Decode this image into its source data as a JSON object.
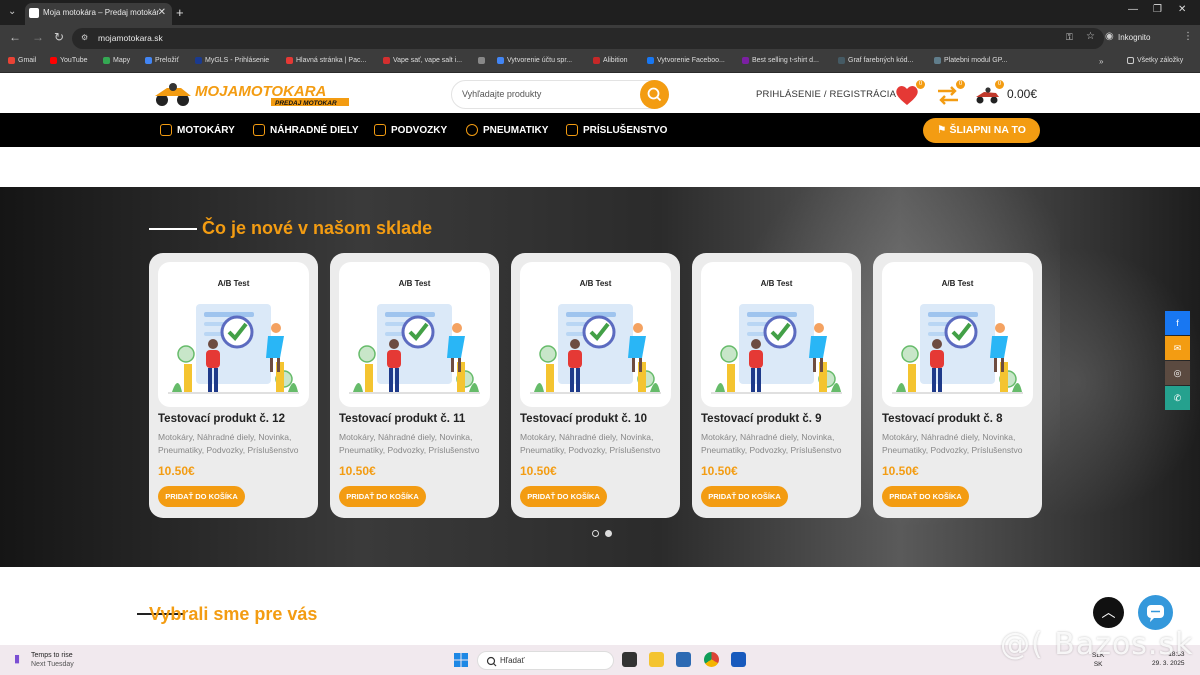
{
  "browser": {
    "tab_title": "Moja motokára – Predaj motokár",
    "url": "mojamotokara.sk",
    "incognito_label": "Inkognito",
    "all_bookmarks": "Všetky záložky",
    "bookmarks": [
      {
        "label": "Gmail",
        "color": "#ea4335"
      },
      {
        "label": "YouTube",
        "color": "#ff0000"
      },
      {
        "label": "Mapy",
        "color": "#34a853"
      },
      {
        "label": "Preložiť",
        "color": "#4285f4"
      },
      {
        "label": "MyGLS - Prihlásenie",
        "color": "#1a3a8f"
      },
      {
        "label": "Hlavná stránka | Pac...",
        "color": "#e53935"
      },
      {
        "label": "Vape sať, vape salt i...",
        "color": "#d32f2f"
      },
      {
        "label": "",
        "color": "#888888"
      },
      {
        "label": "Vytvorenie účtu spr...",
        "color": "#4285f4"
      },
      {
        "label": "Alibition",
        "color": "#c62828"
      },
      {
        "label": "Vytvorenie Faceboo...",
        "color": "#1877f2"
      },
      {
        "label": "Best selling t-shirt d...",
        "color": "#7b1fa2"
      },
      {
        "label": "Graf farebných kód...",
        "color": "#455a64"
      },
      {
        "label": "Platebni modul GP...",
        "color": "#607d8b"
      }
    ]
  },
  "header": {
    "logo_text": "MOJAMOTOKARA",
    "logo_sub": "PREDAJ MOTOKAR",
    "search_placeholder": "Vyhľadajte produkty",
    "login_label": "PRIHLÁSENIE / REGISTRÁCIA",
    "wishlist_count": "0",
    "compare_count": "0",
    "cart_count": "0",
    "cart_total": "0.00€"
  },
  "menu": {
    "items": [
      "MOTOKÁRY",
      "NÁHRADNÉ DIELY",
      "PODVOZKY",
      "PNEUMATIKY",
      "PRÍSLUŠENSTVO"
    ],
    "cta": "ŠLIAPNI NA TO"
  },
  "new_section": {
    "title": "Čo je nové v našom sklade",
    "products": [
      {
        "image_label": "A/B Test",
        "title": "Testovací produkt č. 12",
        "categories": "Motokáry, Náhradné diely, Novinka, Pneumatiky, Podvozky, Príslušenstvo",
        "price": "10.50€",
        "button": "PRIDAŤ DO KOŠÍKA"
      },
      {
        "image_label": "A/B Test",
        "title": "Testovací produkt č. 11",
        "categories": "Motokáry, Náhradné diely, Novinka, Pneumatiky, Podvozky, Príslušenstvo",
        "price": "10.50€",
        "button": "PRIDAŤ DO KOŠÍKA"
      },
      {
        "image_label": "A/B Test",
        "title": "Testovací produkt č. 10",
        "categories": "Motokáry, Náhradné diely, Novinka, Pneumatiky, Podvozky, Príslušenstvo",
        "price": "10.50€",
        "button": "PRIDAŤ DO KOŠÍKA"
      },
      {
        "image_label": "A/B Test",
        "title": "Testovací produkt č. 9",
        "categories": "Motokáry, Náhradné diely, Novinka, Pneumatiky, Podvozky, Príslušenstvo",
        "price": "10.50€",
        "button": "PRIDAŤ DO KOŠÍKA"
      },
      {
        "image_label": "A/B Test",
        "title": "Testovací produkt č. 8",
        "categories": "Motokáry, Náhradné diely, Novinka, Pneumatiky, Podvozky, Príslušenstvo",
        "price": "10.50€",
        "button": "PRIDAŤ DO KOŠÍKA"
      }
    ]
  },
  "picked_section": {
    "title": "Vybrali sme pre vás"
  },
  "social": [
    {
      "icon": "facebook-icon",
      "glyph": "f",
      "color": "#1877f2"
    },
    {
      "icon": "email-icon",
      "glyph": "✉",
      "color": "#f39c12"
    },
    {
      "icon": "instagram-icon",
      "glyph": "◎",
      "color": "#5b4a40"
    },
    {
      "icon": "whatsapp-icon",
      "glyph": "✆",
      "color": "#25a18e"
    }
  ],
  "taskbar": {
    "weather_line1": "Temps to rise",
    "weather_line2": "Next Tuesday",
    "search": "Hľadať",
    "lang1": "SLK",
    "lang2": "SK",
    "time": "18:53",
    "date": "29. 3. 2025"
  },
  "watermark": "@( Bazos.sk",
  "colors": {
    "accent": "#f39c12",
    "menu_bg": "#000000"
  }
}
